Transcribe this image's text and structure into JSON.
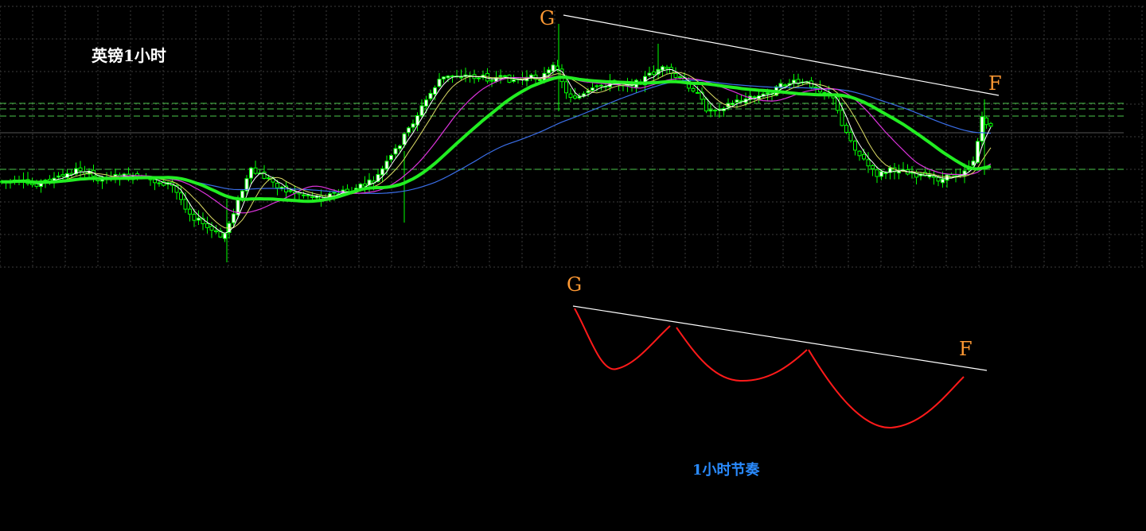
{
  "chart_data": {
    "type": "candlestick",
    "title": "英镑1小时",
    "caption": "1小时节奏",
    "annotations": {
      "top_start_label": "G",
      "top_end_label": "F",
      "sketch_start_label": "G",
      "sketch_end_label": "F"
    },
    "grid": true,
    "colors": {
      "background": "#000000",
      "grid": "#3c3c3c",
      "bull": "#ffffff",
      "bear": "#00ff00",
      "ma_slow_thick": "#22ee22",
      "ma_mid": "#dd33dd",
      "ma_long": "#3a6ee8",
      "ma_fast_white": "#ffffff",
      "ma_fast_yellow": "#dddd66",
      "trendline": "#ffffff",
      "rhythm": "#ff1a1a",
      "label_point": "#ff9933",
      "label_title": "#ffffff",
      "label_caption": "#2a8bff",
      "level_lines": "#4cc84c"
    }
  }
}
